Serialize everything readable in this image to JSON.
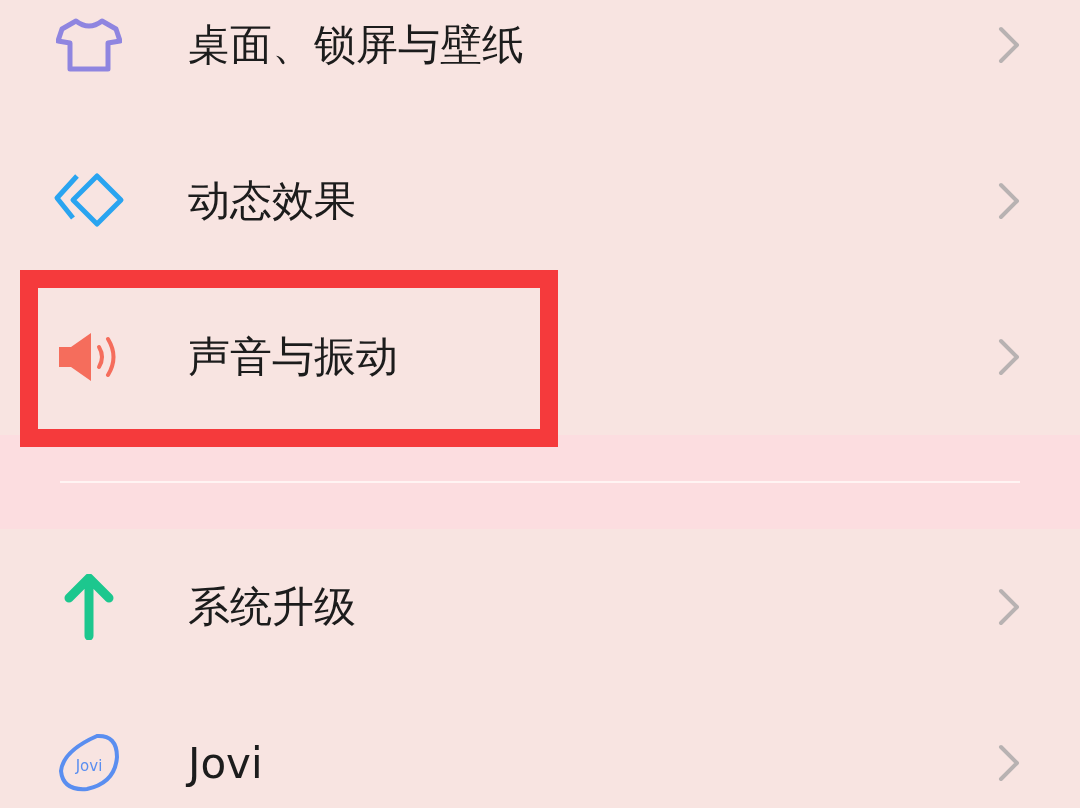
{
  "sections": [
    {
      "items": [
        {
          "kind": "shirt",
          "label": "桌面、锁屏与壁纸",
          "highlighted": false
        },
        {
          "kind": "layers",
          "label": "动态效果",
          "highlighted": false
        },
        {
          "kind": "speaker",
          "label": "声音与振动",
          "highlighted": true
        }
      ]
    },
    {
      "items": [
        {
          "kind": "arrow",
          "label": "系统升级",
          "highlighted": false
        },
        {
          "kind": "jovi",
          "icon_text": "Jovi",
          "label": "Jovi",
          "highlighted": false
        }
      ]
    }
  ]
}
